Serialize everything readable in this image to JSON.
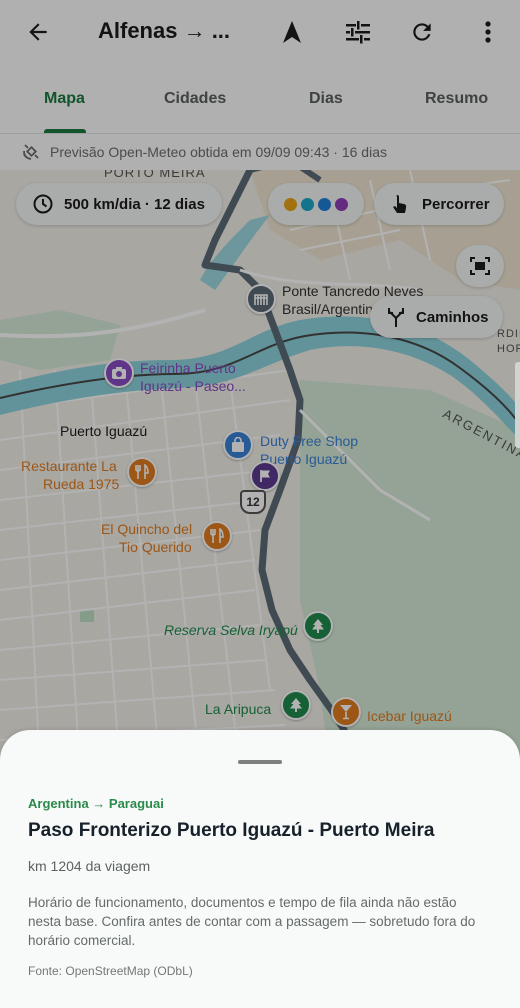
{
  "app_bar": {
    "title": "Alfenas → ...",
    "icons": [
      "back-arrow-icon",
      "navigation-arrow-icon",
      "tune-sliders-icon",
      "refresh-icon",
      "more-vert-icon"
    ]
  },
  "tabs": [
    {
      "label": "Mapa",
      "active": true
    },
    {
      "label": "Cidades",
      "active": false
    },
    {
      "label": "Dias",
      "active": false
    },
    {
      "label": "Resumo",
      "active": false
    }
  ],
  "forecast": {
    "text": "Previsão Open-Meteo obtida em 09/09 09:43 · 16 dias",
    "icon": "satellite-icon"
  },
  "map": {
    "pace_chip": "500 km/dia · 12 dias",
    "day_colors": [
      "#e8a317",
      "#1fa7c9",
      "#1e7fd6",
      "#8f3db8"
    ],
    "traverse_button": "Percorrer",
    "paths_button": "Caminhos",
    "road_shield": "12",
    "labels": {
      "porto_meira": "PORTO MEIRA",
      "ponte_line1": "Ponte Tancredo Neves",
      "ponte_line2": "Brasil/Argentina",
      "feirinha_line1": "Feirinha Puerto",
      "feirinha_line2": "Iguazú - Paseo...",
      "puerto_iguazu": "Puerto Iguazú",
      "duty_line1": "Duty Free Shop",
      "duty_line2": "Puerto Iguazú",
      "rueda_line1": "Restaurante La",
      "rueda_line2": "Rueda 1975",
      "quincho_line1": "El Quincho del",
      "quincho_line2": "Tio Querido",
      "reserva": "Reserva Selva Iryapú",
      "aripuca": "La Aripuca",
      "icebar": "Icebar Iguazú",
      "argentina": "ARGENTINA",
      "edge_1": "RDIM",
      "edge_2": "HORIZ"
    },
    "colors": {
      "water": "#8fd3dd",
      "park": "#cfe8d2",
      "route": "#5b6a77",
      "food": "#e07b1f",
      "shop": "#3a83d6",
      "nature": "#1f8a4c",
      "culture": "#8a4bc4"
    }
  },
  "sheet": {
    "route": "Argentina → Paraguai",
    "title": "Paso Fronterizo Puerto Iguazú - Puerto Meira",
    "km": "km 1204 da viagem",
    "description": "Horário de funcionamento, documentos e tempo de fila ainda não estão nesta base. Confira antes de contar com a passagem — sobretudo fora do horário comercial.",
    "source": "Fonte: OpenStreetMap (ODbL)"
  }
}
